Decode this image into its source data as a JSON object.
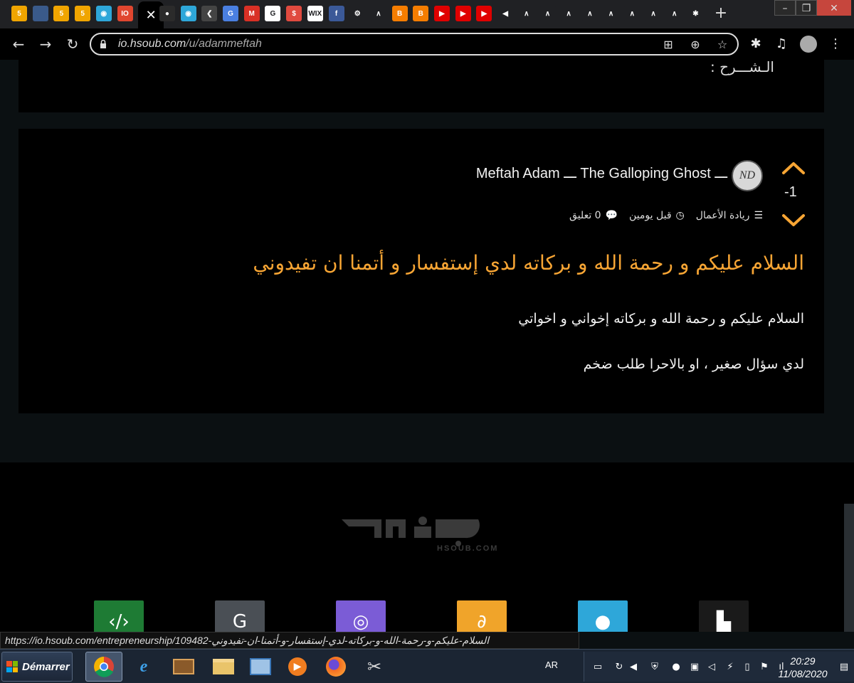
{
  "browser": {
    "tabs": [
      {
        "icon": "b5-icon",
        "glyph": "5",
        "color": "#f0a500"
      },
      {
        "icon": "site-icon",
        "glyph": "",
        "color": "#3a5a8a"
      },
      {
        "icon": "b5-icon",
        "glyph": "5",
        "color": "#f0a500"
      },
      {
        "icon": "b5-icon",
        "glyph": "5",
        "color": "#f0a500"
      },
      {
        "icon": "circle-app-icon",
        "glyph": "◉",
        "color": "#2ea7d9"
      },
      {
        "icon": "io-icon",
        "glyph": "IO",
        "color": "#e0462f"
      },
      {
        "icon": "close-tab-icon",
        "glyph": "✕",
        "color": "#000000"
      },
      {
        "icon": "dot-icon",
        "glyph": "●",
        "color": "#2b2b2b"
      },
      {
        "icon": "circle-app-icon",
        "glyph": "◉",
        "color": "#2ea7d9"
      },
      {
        "icon": "khamsat-icon",
        "glyph": "❮",
        "color": "#444444"
      },
      {
        "icon": "translate-icon",
        "glyph": "G",
        "color": "#4a7fe0"
      },
      {
        "icon": "gmail-icon",
        "glyph": "M",
        "color": "#d93025"
      },
      {
        "icon": "google-icon",
        "glyph": "G",
        "color": "#ffffff"
      },
      {
        "icon": "dollar-icon",
        "glyph": "$",
        "color": "#e04a3f"
      },
      {
        "icon": "wix-icon",
        "glyph": "WIX",
        "color": "#ffffff"
      },
      {
        "icon": "facebook-icon",
        "glyph": "f",
        "color": "#3b5998"
      },
      {
        "icon": "gear-icon",
        "glyph": "⚙",
        "color": "#202124"
      },
      {
        "icon": "a-icon",
        "glyph": "∧",
        "color": "#202124"
      },
      {
        "icon": "blogger-icon",
        "glyph": "B",
        "color": "#f57d00"
      },
      {
        "icon": "blogger-icon",
        "glyph": "B",
        "color": "#f57d00"
      },
      {
        "icon": "youtube-icon",
        "glyph": "▶",
        "color": "#e00000"
      },
      {
        "icon": "youtube-icon",
        "glyph": "▶",
        "color": "#e00000"
      },
      {
        "icon": "youtube-icon",
        "glyph": "▶",
        "color": "#e00000"
      },
      {
        "icon": "speaker-icon",
        "glyph": "◀",
        "color": "#202124"
      },
      {
        "icon": "a-icon",
        "glyph": "∧",
        "color": "#202124"
      },
      {
        "icon": "a-icon",
        "glyph": "∧",
        "color": "#202124"
      },
      {
        "icon": "a-icon",
        "glyph": "∧",
        "color": "#202124"
      },
      {
        "icon": "a-icon",
        "glyph": "∧",
        "color": "#202124"
      },
      {
        "icon": "a-icon",
        "glyph": "∧",
        "color": "#202124"
      },
      {
        "icon": "a-icon",
        "glyph": "∧",
        "color": "#202124"
      },
      {
        "icon": "a-icon",
        "glyph": "∧",
        "color": "#202124"
      },
      {
        "icon": "a-icon",
        "glyph": "∧",
        "color": "#202124"
      },
      {
        "icon": "puzzle-icon",
        "glyph": "✱",
        "color": "#202124"
      }
    ],
    "new_tab": "+",
    "url_host": "io.hsoub.com",
    "url_path": "/u/adammeftah"
  },
  "page": {
    "prev_card_label": "الـشـــرح :",
    "post": {
      "score": "-1",
      "author": "Meftah Adam ـــ The Galloping Ghost ـــ",
      "avatar_text": "ND",
      "community": "ريادة الأعمال",
      "time": "قبل يومين",
      "comments": "0 تعليق",
      "title": "السلام عليكم و رحمة الله و بركاته لدي إستفسار و أتمنا ان تفيدوني",
      "body": [
        "السلام عليكم و رحمة الله و بركاته إخواني و اخواتي",
        "لدي سؤال صغير ، او بالاحرا طلب ضخم"
      ]
    },
    "footer": {
      "logo_sub": "HSOUB.COM",
      "products": [
        {
          "icon": "mostaql-icon",
          "color": "#1e7b34"
        },
        {
          "icon": "khamsat-icon",
          "color": "#4a4f55"
        },
        {
          "icon": "baaeed-icon",
          "color": "#7b5cd6"
        },
        {
          "icon": "ana-icon",
          "color": "#f0a42a"
        },
        {
          "icon": "io-circle-icon",
          "color": "#2ea7d9"
        },
        {
          "icon": "hsoub-academy-icon",
          "color": "#1a1a1a"
        }
      ]
    }
  },
  "status_url": "https://io.hsoub.com/entrepreneurship/109482-السلام-عليكم-و-رحمة-الله-و-بركاته-لدي-إستفسار-و-أتمنا-ان-تفيدوني",
  "taskbar": {
    "start_label": "Démarrer",
    "lang": "AR",
    "time": "20:29",
    "date": "11/08/2020"
  }
}
